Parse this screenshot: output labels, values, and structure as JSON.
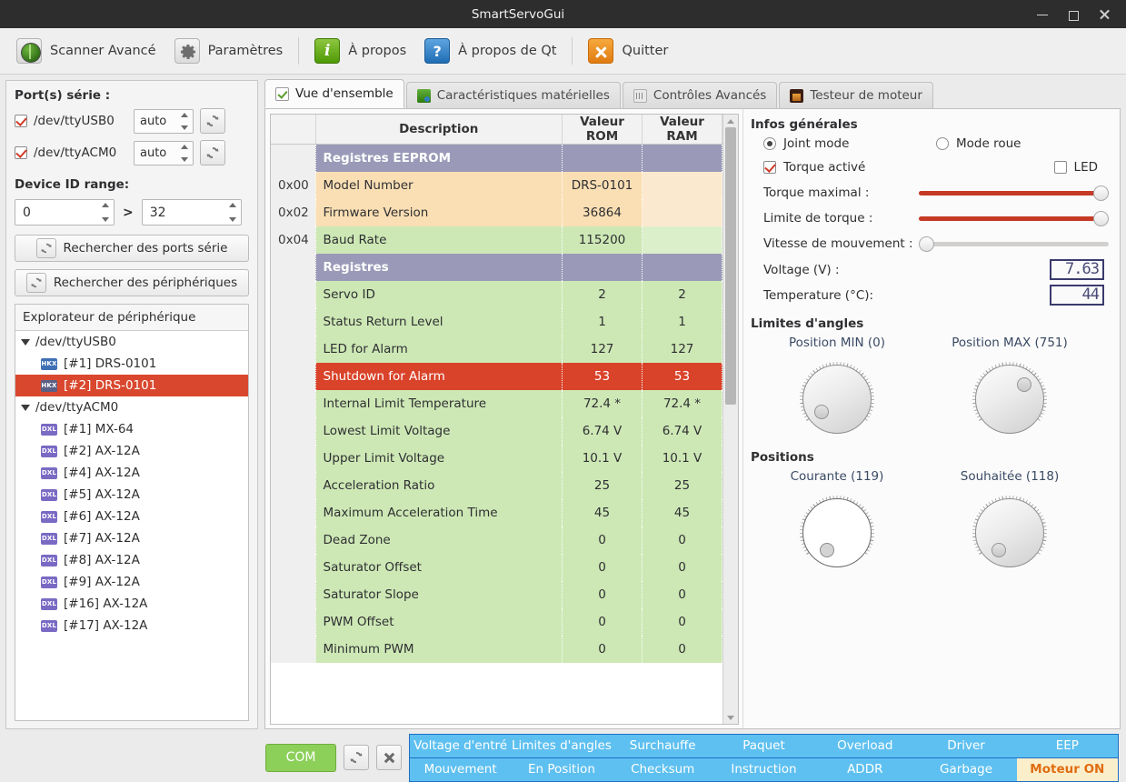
{
  "window": {
    "title": "SmartServoGui",
    "minimize": "minimize-icon",
    "maximize": "maximize-icon",
    "close": "close-icon"
  },
  "toolbar": {
    "items": [
      {
        "label": "Scanner Avancé",
        "icon": "radar-icon"
      },
      {
        "label": "Paramètres",
        "icon": "gear-icon"
      },
      {
        "label": "À propos",
        "icon": "info-icon"
      },
      {
        "label": "À propos de Qt",
        "icon": "qt-help-icon"
      },
      {
        "label": "Quitter",
        "icon": "quit-icon"
      }
    ]
  },
  "sidebar": {
    "ports_title": "Port(s) série :",
    "ports": [
      {
        "name": "/dev/ttyUSB0",
        "checked": true,
        "baud": "auto"
      },
      {
        "name": "/dev/ttyACM0",
        "checked": true,
        "baud": "auto"
      }
    ],
    "id_range_title": "Device ID range:",
    "id_min": "0",
    "id_sep": ">",
    "id_max": "32",
    "scan_ports_label": "Rechercher des ports série",
    "scan_devices_label": "Rechercher des périphériques",
    "tree_title": "Explorateur de périphérique",
    "tree": [
      {
        "type": "root",
        "label": "/dev/ttyUSB0"
      },
      {
        "type": "dev",
        "badge": "HKX",
        "label": "[#1] DRS-0101",
        "selected": false
      },
      {
        "type": "dev",
        "badge": "HKX",
        "label": "[#2] DRS-0101",
        "selected": true
      },
      {
        "type": "root",
        "label": "/dev/ttyACM0"
      },
      {
        "type": "dev",
        "badge": "DXL",
        "label": "[#1] MX-64",
        "selected": false
      },
      {
        "type": "dev",
        "badge": "DXL",
        "label": "[#2] AX-12A",
        "selected": false
      },
      {
        "type": "dev",
        "badge": "DXL",
        "label": "[#4] AX-12A",
        "selected": false
      },
      {
        "type": "dev",
        "badge": "DXL",
        "label": "[#5] AX-12A",
        "selected": false
      },
      {
        "type": "dev",
        "badge": "DXL",
        "label": "[#6] AX-12A",
        "selected": false
      },
      {
        "type": "dev",
        "badge": "DXL",
        "label": "[#7] AX-12A",
        "selected": false
      },
      {
        "type": "dev",
        "badge": "DXL",
        "label": "[#8] AX-12A",
        "selected": false
      },
      {
        "type": "dev",
        "badge": "DXL",
        "label": "[#9] AX-12A",
        "selected": false
      },
      {
        "type": "dev",
        "badge": "DXL",
        "label": "[#16] AX-12A",
        "selected": false
      },
      {
        "type": "dev",
        "badge": "DXL",
        "label": "[#17] AX-12A",
        "selected": false
      }
    ]
  },
  "tabs": [
    {
      "label": "Vue d'ensemble",
      "icon": "check-icon",
      "active": true
    },
    {
      "label": "Caractéristiques matérielles",
      "icon": "hardware-icon",
      "active": false
    },
    {
      "label": "Contrôles Avancés",
      "icon": "sliders-icon",
      "active": false
    },
    {
      "label": "Testeur de moteur",
      "icon": "motor-icon",
      "active": false
    }
  ],
  "table": {
    "headers": [
      "",
      "Description",
      "Valeur ROM",
      "Valeur RAM"
    ],
    "rows": [
      {
        "kind": "section",
        "addr": "",
        "desc": "Registres EEPROM",
        "rom": "",
        "ram": ""
      },
      {
        "kind": "eeprom",
        "addr": "0x00",
        "desc": "Model Number",
        "rom": "DRS-0101",
        "ram": ""
      },
      {
        "kind": "eeprom",
        "addr": "0x02",
        "desc": "Firmware Version",
        "rom": "36864",
        "ram": ""
      },
      {
        "kind": "green-empty",
        "addr": "0x04",
        "desc": "Baud Rate",
        "rom": "115200",
        "ram": ""
      },
      {
        "kind": "section",
        "addr": "",
        "desc": "Registres",
        "rom": "",
        "ram": ""
      },
      {
        "kind": "green",
        "addr": "",
        "desc": "Servo ID",
        "rom": "2",
        "ram": "2"
      },
      {
        "kind": "green",
        "addr": "",
        "desc": "Status Return Level",
        "rom": "1",
        "ram": "1"
      },
      {
        "kind": "green",
        "addr": "",
        "desc": "LED for Alarm",
        "rom": "127",
        "ram": "127"
      },
      {
        "kind": "alarm",
        "addr": "",
        "desc": "Shutdown for Alarm",
        "rom": "53",
        "ram": "53"
      },
      {
        "kind": "green",
        "addr": "",
        "desc": "Internal Limit Temperature",
        "rom": "72.4 *",
        "ram": "72.4 *"
      },
      {
        "kind": "green",
        "addr": "",
        "desc": "Lowest Limit Voltage",
        "rom": "6.74 V",
        "ram": "6.74 V"
      },
      {
        "kind": "green",
        "addr": "",
        "desc": "Upper Limit Voltage",
        "rom": "10.1 V",
        "ram": "10.1 V"
      },
      {
        "kind": "green",
        "addr": "",
        "desc": "Acceleration Ratio",
        "rom": "25",
        "ram": "25"
      },
      {
        "kind": "green",
        "addr": "",
        "desc": "Maximum Acceleration Time",
        "rom": "45",
        "ram": "45"
      },
      {
        "kind": "green",
        "addr": "",
        "desc": "Dead Zone",
        "rom": "0",
        "ram": "0"
      },
      {
        "kind": "green",
        "addr": "",
        "desc": "Saturator Offset",
        "rom": "0",
        "ram": "0"
      },
      {
        "kind": "green",
        "addr": "",
        "desc": "Saturator Slope",
        "rom": "0",
        "ram": "0"
      },
      {
        "kind": "green",
        "addr": "",
        "desc": "PWM Offset",
        "rom": "0",
        "ram": "0"
      },
      {
        "kind": "green",
        "addr": "",
        "desc": "Minimum PWM",
        "rom": "0",
        "ram": "0"
      }
    ]
  },
  "info": {
    "title": "Infos générales",
    "mode_joint": "Joint mode",
    "mode_joint_selected": true,
    "mode_wheel": "Mode roue",
    "mode_wheel_selected": false,
    "torque_enabled_label": "Torque activé",
    "torque_enabled": true,
    "led_label": "LED",
    "led_on": false,
    "sliders": [
      {
        "label": "Torque maximal :",
        "percent": 100,
        "filled": true
      },
      {
        "label": "Limite de torque :",
        "percent": 100,
        "filled": true
      },
      {
        "label": "Vitesse de mouvement :",
        "percent": 0,
        "filled": false
      }
    ],
    "voltage_label": "Voltage (V) :",
    "voltage_value": "7.63",
    "temperature_label": "Temperature (°C):",
    "temperature_value": "44"
  },
  "angles": {
    "title": "Limites d'angles",
    "knobs": [
      {
        "caption": "Position MIN (0)",
        "angle": -140,
        "enabled": true
      },
      {
        "caption": "Position MAX (751)",
        "angle": 45,
        "enabled": true
      }
    ]
  },
  "positions": {
    "title": "Positions",
    "knobs": [
      {
        "caption": "Courante (119)",
        "angle": -120,
        "enabled": false
      },
      {
        "caption": "Souhaitée (118)",
        "angle": -122,
        "enabled": true
      }
    ]
  },
  "bottom": {
    "com_label": "COM",
    "refresh_icon": "refresh-icon",
    "stop_icon": "close-x-icon",
    "status_rows": [
      [
        {
          "label": "Voltage d'entré",
          "on": false
        },
        {
          "label": "Limites d'angles",
          "on": false
        },
        {
          "label": "Surchauffe",
          "on": false
        },
        {
          "label": "Paquet",
          "on": false
        },
        {
          "label": "Overload",
          "on": false
        },
        {
          "label": "Driver",
          "on": false
        },
        {
          "label": "EEP",
          "on": false
        }
      ],
      [
        {
          "label": "Mouvement",
          "on": false
        },
        {
          "label": "En Position",
          "on": false
        },
        {
          "label": "Checksum",
          "on": false
        },
        {
          "label": "Instruction",
          "on": false
        },
        {
          "label": "ADDR",
          "on": false
        },
        {
          "label": "Garbage",
          "on": false
        },
        {
          "label": "Moteur ON",
          "on": true
        }
      ]
    ]
  }
}
